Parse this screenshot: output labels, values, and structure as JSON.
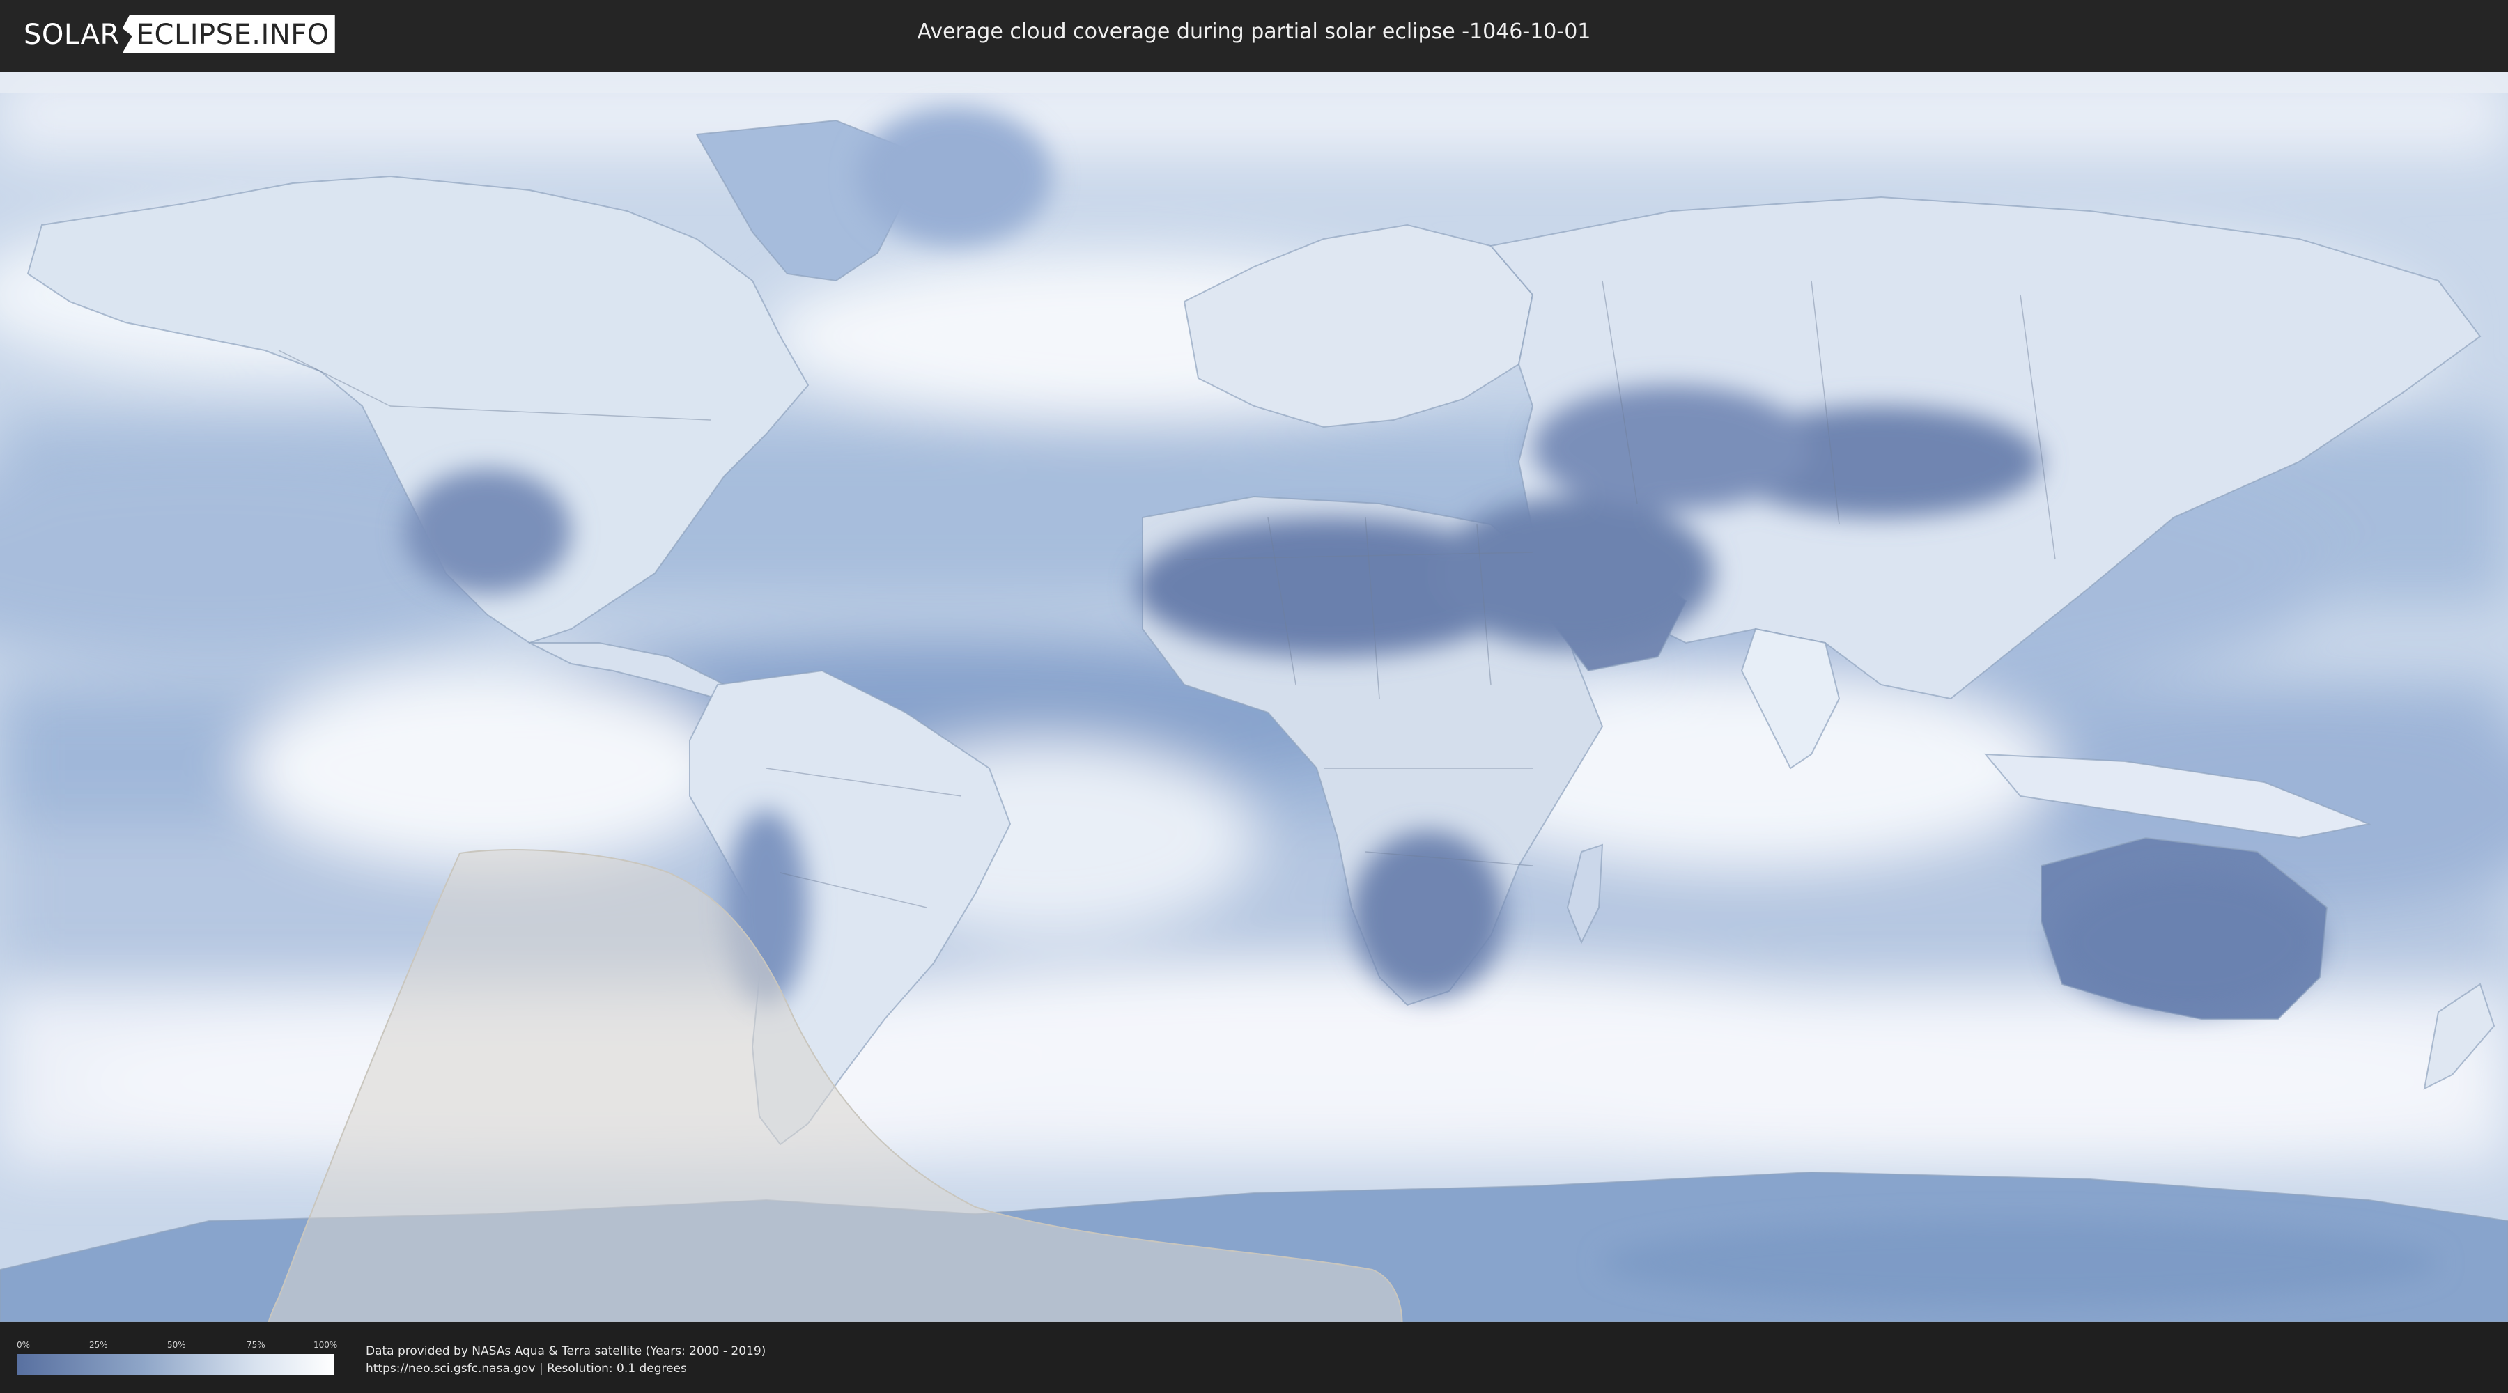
{
  "header": {
    "logo_part1": "SOLAR",
    "logo_part2": "ECLIPSE.INFO",
    "title": "Average cloud coverage during partial solar eclipse -1046-10-01"
  },
  "legend": {
    "ticks": [
      "0%",
      "25%",
      "50%",
      "75%",
      "100%"
    ],
    "colors": {
      "low": "#5870a0",
      "high": "#ffffff"
    }
  },
  "footer": {
    "credit_line1": "Data provided by NASAs Aqua & Terra satellite (Years: 2000 - 2019)",
    "credit_line2": "https://neo.sci.gsfc.nasa.gov | Resolution: 0.1 degrees"
  },
  "map": {
    "projection": "equirectangular",
    "cloud_colors": {
      "ocean_clear": "#7b98c6",
      "cloud": "#ffffff",
      "land_clear": "#5a72a6"
    },
    "eclipse_zone_color": "#d8d6d0"
  }
}
